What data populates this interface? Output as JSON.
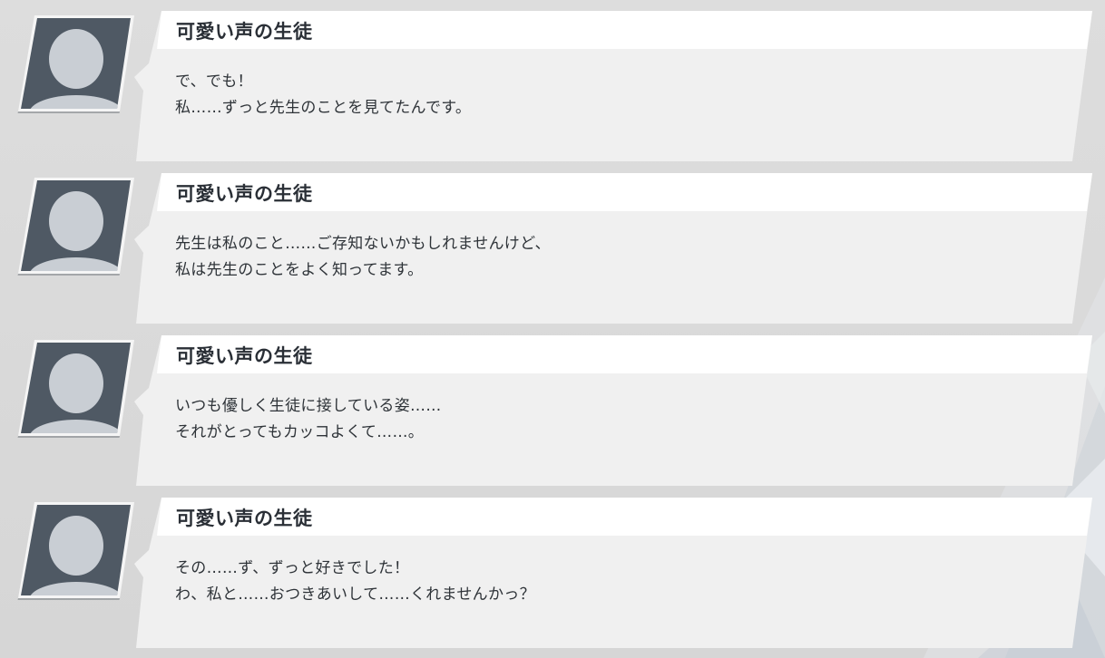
{
  "theme": {
    "background": "#d9d9d9",
    "bubble": "#f0f0f0",
    "bubble_header": "#ffffff",
    "avatar_frame": "#4f5964",
    "avatar_silhouette": "#c9ced4",
    "text": "#2e3338"
  },
  "log": {
    "entries": [
      {
        "speaker": "可愛い声の生徒",
        "lines": [
          "で、でも！",
          "私……ずっと先生のことを見てたんです。"
        ],
        "avatar_icon": "person-silhouette-icon"
      },
      {
        "speaker": "可愛い声の生徒",
        "lines": [
          "先生は私のこと……ご存知ないかもしれませんけど、",
          "私は先生のことをよく知ってます。"
        ],
        "avatar_icon": "person-silhouette-icon"
      },
      {
        "speaker": "可愛い声の生徒",
        "lines": [
          "いつも優しく生徒に接している姿……",
          "それがとってもカッコよくて……。"
        ],
        "avatar_icon": "person-silhouette-icon"
      },
      {
        "speaker": "可愛い声の生徒",
        "lines": [
          "その……ず、ずっと好きでした！",
          "わ、私と……おつきあいして……くれませんかっ？"
        ],
        "avatar_icon": "person-silhouette-icon"
      }
    ]
  }
}
